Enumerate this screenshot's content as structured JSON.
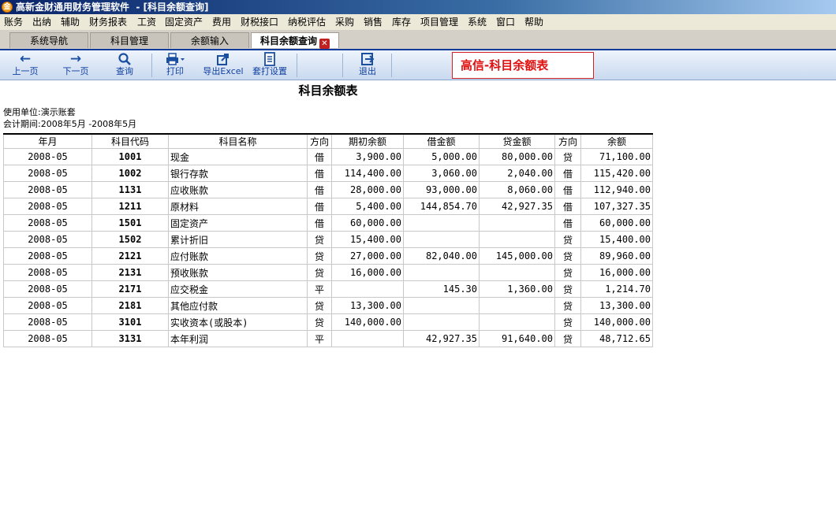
{
  "window": {
    "title": "高新金财通用财务管理软件  - [科目余额查询]"
  },
  "menu": [
    "账务",
    "出纳",
    "辅助",
    "财务报表",
    "工资",
    "固定资产",
    "费用",
    "财税接口",
    "纳税评估",
    "采购",
    "销售",
    "库存",
    "项目管理",
    "系统",
    "窗口",
    "帮助"
  ],
  "tabs": [
    "系统导航",
    "科目管理",
    "余额输入",
    "科目余额查询"
  ],
  "toolbar": {
    "prev": "上一页",
    "next": "下一页",
    "query": "查询",
    "print": "打印",
    "export": "导出Excel",
    "print_setup": "套打设置",
    "exit": "退出"
  },
  "brand": "高信-科目余额表",
  "report": {
    "title": "科目余额表",
    "unit": "使用单位:演示账套",
    "period": "会计期间:2008年5月 -2008年5月"
  },
  "table": {
    "headers": [
      "年月",
      "科目代码",
      "科目名称",
      "方向",
      "期初余额",
      "借金额",
      "贷金额",
      "方向",
      "余额"
    ],
    "rows": [
      [
        "2008-05",
        "1001",
        "现金",
        "借",
        "3,900.00",
        "5,000.00",
        "80,000.00",
        "贷",
        "71,100.00"
      ],
      [
        "2008-05",
        "1002",
        "银行存款",
        "借",
        "114,400.00",
        "3,060.00",
        "2,040.00",
        "借",
        "115,420.00"
      ],
      [
        "2008-05",
        "1131",
        "应收账款",
        "借",
        "28,000.00",
        "93,000.00",
        "8,060.00",
        "借",
        "112,940.00"
      ],
      [
        "2008-05",
        "1211",
        "原材料",
        "借",
        "5,400.00",
        "144,854.70",
        "42,927.35",
        "借",
        "107,327.35"
      ],
      [
        "2008-05",
        "1501",
        "固定资产",
        "借",
        "60,000.00",
        "",
        "",
        "借",
        "60,000.00"
      ],
      [
        "2008-05",
        "1502",
        "累计折旧",
        "贷",
        "15,400.00",
        "",
        "",
        "贷",
        "15,400.00"
      ],
      [
        "2008-05",
        "2121",
        "应付账款",
        "贷",
        "27,000.00",
        "82,040.00",
        "145,000.00",
        "贷",
        "89,960.00"
      ],
      [
        "2008-05",
        "2131",
        "预收账款",
        "贷",
        "16,000.00",
        "",
        "",
        "贷",
        "16,000.00"
      ],
      [
        "2008-05",
        "2171",
        "应交税金",
        "平",
        "",
        "145.30",
        "1,360.00",
        "贷",
        "1,214.70"
      ],
      [
        "2008-05",
        "2181",
        "其他应付款",
        "贷",
        "13,300.00",
        "",
        "",
        "贷",
        "13,300.00"
      ],
      [
        "2008-05",
        "3101",
        "实收资本(或股本)",
        "贷",
        "140,000.00",
        "",
        "",
        "贷",
        "140,000.00"
      ],
      [
        "2008-05",
        "3131",
        "本年利润",
        "平",
        "",
        "42,927.35",
        "91,640.00",
        "贷",
        "48,712.65"
      ]
    ]
  }
}
